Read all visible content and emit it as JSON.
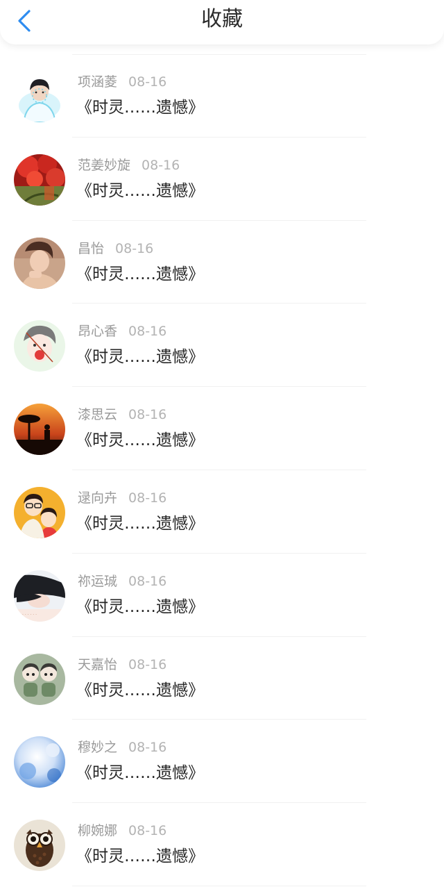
{
  "header": {
    "title": "收藏",
    "back_icon": "chevron-left-icon",
    "accent_color": "#2e8cf0"
  },
  "items": [
    {
      "user": "项涵菱",
      "date": "08-16",
      "content": "《时灵……遗憾》"
    },
    {
      "user": "范姜妙旋",
      "date": "08-16",
      "content": "《时灵……遗憾》"
    },
    {
      "user": "昌怡",
      "date": "08-16",
      "content": "《时灵……遗憾》"
    },
    {
      "user": "昂心香",
      "date": "08-16",
      "content": "《时灵……遗憾》"
    },
    {
      "user": "漆思云",
      "date": "08-16",
      "content": "《时灵……遗憾》"
    },
    {
      "user": "逯向卉",
      "date": "08-16",
      "content": "《时灵……遗憾》"
    },
    {
      "user": "祢运珹",
      "date": "08-16",
      "content": "《时灵……遗憾》"
    },
    {
      "user": "天嘉怡",
      "date": "08-16",
      "content": "《时灵……遗憾》"
    },
    {
      "user": "穆妙之",
      "date": "08-16",
      "content": "《时灵……遗憾》"
    },
    {
      "user": "柳婉娜",
      "date": "08-16",
      "content": "《时灵……遗憾》"
    }
  ]
}
